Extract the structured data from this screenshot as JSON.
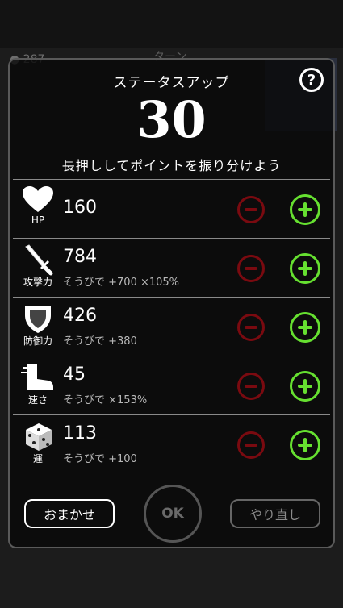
{
  "background": {
    "coin_count": "287",
    "turn_label": "ターン"
  },
  "dialog": {
    "title": "ステータスアップ",
    "points": "30",
    "hint": "長押ししてポイントを振り分けよう",
    "help_label": "?"
  },
  "stats": [
    {
      "icon": "heart-icon",
      "label": "HP",
      "value": "160",
      "equip": ""
    },
    {
      "icon": "sword-icon",
      "label": "攻撃力",
      "value": "784",
      "equip": "そうびで +700 ×105%"
    },
    {
      "icon": "shield-icon",
      "label": "防御力",
      "value": "426",
      "equip": "そうびで +380"
    },
    {
      "icon": "boot-icon",
      "label": "速さ",
      "value": "45",
      "equip": "そうびで ×153%"
    },
    {
      "icon": "dice-icon",
      "label": "運",
      "value": "113",
      "equip": "そうびで +100"
    }
  ],
  "buttons": {
    "omakase": "おまかせ",
    "ok": "OK",
    "redo": "やり直し"
  },
  "colors": {
    "plus": "#66e030",
    "minus": "#7a0a10",
    "panel": "#080808"
  }
}
